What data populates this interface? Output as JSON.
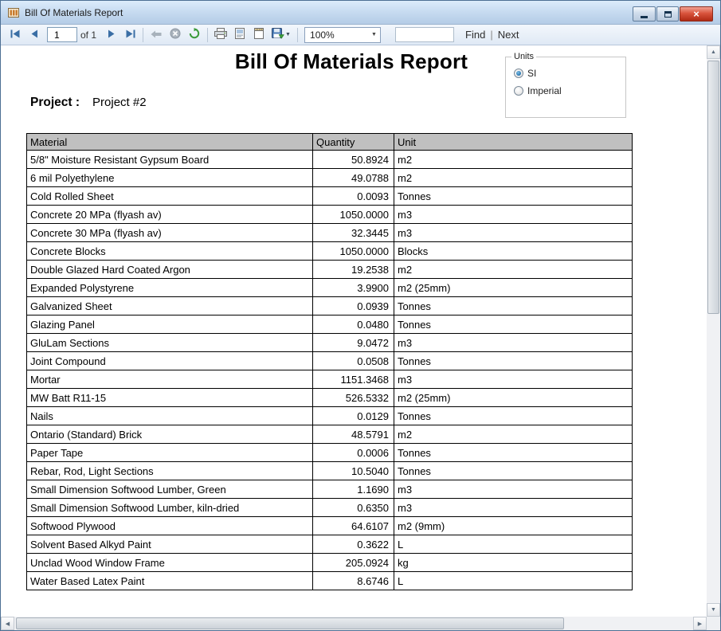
{
  "window": {
    "title": "Bill Of Materials Report"
  },
  "toolbar": {
    "page_number": "1",
    "of_label": "of 1",
    "zoom_value": "100%",
    "search_value": "",
    "find_label": "Find",
    "find_separator": "|",
    "next_label": "Next"
  },
  "glyphs": {
    "close": "×",
    "dropdown": "▼",
    "scroll_up": "▲",
    "scroll_down": "▼",
    "scroll_left": "◀",
    "scroll_right": "▶"
  },
  "report": {
    "title": "Bill Of Materials Report",
    "units_group": {
      "label": "Units",
      "options": [
        {
          "label": "SI",
          "selected": true
        },
        {
          "label": "Imperial",
          "selected": false
        }
      ]
    },
    "project_label": "Project :",
    "project_value": "Project #2"
  },
  "table": {
    "headers": [
      "Material",
      "Quantity",
      "Unit"
    ],
    "rows": [
      [
        "5/8\"  Moisture Resistant Gypsum Board",
        "50.8924",
        "m2"
      ],
      [
        "6 mil Polyethylene",
        "49.0788",
        "m2"
      ],
      [
        "Cold Rolled Sheet",
        "0.0093",
        "Tonnes"
      ],
      [
        "Concrete 20 MPa (flyash av)",
        "1050.0000",
        "m3"
      ],
      [
        "Concrete 30 MPa (flyash av)",
        "32.3445",
        "m3"
      ],
      [
        "Concrete Blocks",
        "1050.0000",
        "Blocks"
      ],
      [
        "Double Glazed Hard Coated Argon",
        "19.2538",
        "m2"
      ],
      [
        "Expanded Polystyrene",
        "3.9900",
        "m2 (25mm)"
      ],
      [
        "Galvanized Sheet",
        "0.0939",
        "Tonnes"
      ],
      [
        "Glazing Panel",
        "0.0480",
        "Tonnes"
      ],
      [
        "GluLam Sections",
        "9.0472",
        "m3"
      ],
      [
        "Joint Compound",
        "0.0508",
        "Tonnes"
      ],
      [
        "Mortar",
        "1151.3468",
        "m3"
      ],
      [
        "MW Batt R11-15",
        "526.5332",
        "m2 (25mm)"
      ],
      [
        "Nails",
        "0.0129",
        "Tonnes"
      ],
      [
        "Ontario (Standard) Brick",
        "48.5791",
        "m2"
      ],
      [
        "Paper Tape",
        "0.0006",
        "Tonnes"
      ],
      [
        "Rebar, Rod, Light Sections",
        "10.5040",
        "Tonnes"
      ],
      [
        "Small Dimension Softwood Lumber, Green",
        "1.1690",
        "m3"
      ],
      [
        "Small Dimension Softwood Lumber, kiln-dried",
        "0.6350",
        "m3"
      ],
      [
        "Softwood Plywood",
        "64.6107",
        "m2 (9mm)"
      ],
      [
        "Solvent Based Alkyd Paint",
        "0.3622",
        "L"
      ],
      [
        "Unclad Wood Window Frame",
        "205.0924",
        "kg"
      ],
      [
        "Water Based Latex Paint",
        "8.6746",
        "L"
      ]
    ]
  }
}
